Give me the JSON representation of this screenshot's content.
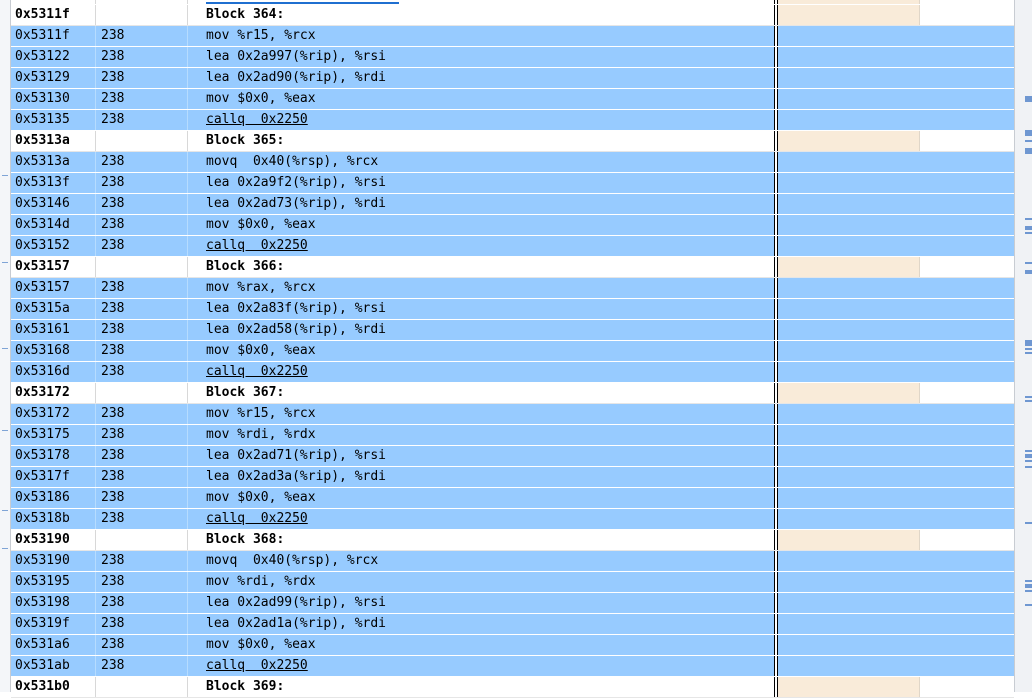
{
  "rows": [
    {
      "kind": "partial",
      "addr": "",
      "line": "",
      "asm": ""
    },
    {
      "kind": "block",
      "addr": "0x5311f",
      "line": "",
      "asm": "Block 364:"
    },
    {
      "kind": "code",
      "addr": "0x5311f",
      "line": "238",
      "asm": "mov %r15, %rcx"
    },
    {
      "kind": "code",
      "addr": "0x53122",
      "line": "238",
      "asm": "lea 0x2a997(%rip), %rsi"
    },
    {
      "kind": "code",
      "addr": "0x53129",
      "line": "238",
      "asm": "lea 0x2ad90(%rip), %rdi"
    },
    {
      "kind": "code",
      "addr": "0x53130",
      "line": "238",
      "asm": "mov $0x0, %eax"
    },
    {
      "kind": "code",
      "addr": "0x53135",
      "line": "238",
      "asm": "callq  0x2250",
      "call": true
    },
    {
      "kind": "block",
      "addr": "0x5313a",
      "line": "",
      "asm": "Block 365:"
    },
    {
      "kind": "code",
      "addr": "0x5313a",
      "line": "238",
      "asm": "movq  0x40(%rsp), %rcx"
    },
    {
      "kind": "code",
      "addr": "0x5313f",
      "line": "238",
      "asm": "lea 0x2a9f2(%rip), %rsi"
    },
    {
      "kind": "code",
      "addr": "0x53146",
      "line": "238",
      "asm": "lea 0x2ad73(%rip), %rdi"
    },
    {
      "kind": "code",
      "addr": "0x5314d",
      "line": "238",
      "asm": "mov $0x0, %eax"
    },
    {
      "kind": "code",
      "addr": "0x53152",
      "line": "238",
      "asm": "callq  0x2250",
      "call": true
    },
    {
      "kind": "block",
      "addr": "0x53157",
      "line": "",
      "asm": "Block 366:"
    },
    {
      "kind": "code",
      "addr": "0x53157",
      "line": "238",
      "asm": "mov %rax, %rcx"
    },
    {
      "kind": "code",
      "addr": "0x5315a",
      "line": "238",
      "asm": "lea 0x2a83f(%rip), %rsi"
    },
    {
      "kind": "code",
      "addr": "0x53161",
      "line": "238",
      "asm": "lea 0x2ad58(%rip), %rdi"
    },
    {
      "kind": "code",
      "addr": "0x53168",
      "line": "238",
      "asm": "mov $0x0, %eax"
    },
    {
      "kind": "code",
      "addr": "0x5316d",
      "line": "238",
      "asm": "callq  0x2250",
      "call": true
    },
    {
      "kind": "block",
      "addr": "0x53172",
      "line": "",
      "asm": "Block 367:"
    },
    {
      "kind": "code",
      "addr": "0x53172",
      "line": "238",
      "asm": "mov %r15, %rcx"
    },
    {
      "kind": "code",
      "addr": "0x53175",
      "line": "238",
      "asm": "mov %rdi, %rdx"
    },
    {
      "kind": "code",
      "addr": "0x53178",
      "line": "238",
      "asm": "lea 0x2ad71(%rip), %rsi"
    },
    {
      "kind": "code",
      "addr": "0x5317f",
      "line": "238",
      "asm": "lea 0x2ad3a(%rip), %rdi"
    },
    {
      "kind": "code",
      "addr": "0x53186",
      "line": "238",
      "asm": "mov $0x0, %eax"
    },
    {
      "kind": "code",
      "addr": "0x5318b",
      "line": "238",
      "asm": "callq  0x2250",
      "call": true
    },
    {
      "kind": "block",
      "addr": "0x53190",
      "line": "",
      "asm": "Block 368:"
    },
    {
      "kind": "code",
      "addr": "0x53190",
      "line": "238",
      "asm": "movq  0x40(%rsp), %rcx"
    },
    {
      "kind": "code",
      "addr": "0x53195",
      "line": "238",
      "asm": "mov %rdi, %rdx"
    },
    {
      "kind": "code",
      "addr": "0x53198",
      "line": "238",
      "asm": "lea 0x2ad99(%rip), %rsi"
    },
    {
      "kind": "code",
      "addr": "0x5319f",
      "line": "238",
      "asm": "lea 0x2ad1a(%rip), %rdi"
    },
    {
      "kind": "code",
      "addr": "0x531a6",
      "line": "238",
      "asm": "mov $0x0, %eax"
    },
    {
      "kind": "code",
      "addr": "0x531ab",
      "line": "238",
      "asm": "callq  0x2250",
      "call": true
    },
    {
      "kind": "block",
      "addr": "0x531b0",
      "line": "",
      "asm": "Block 369:"
    }
  ]
}
